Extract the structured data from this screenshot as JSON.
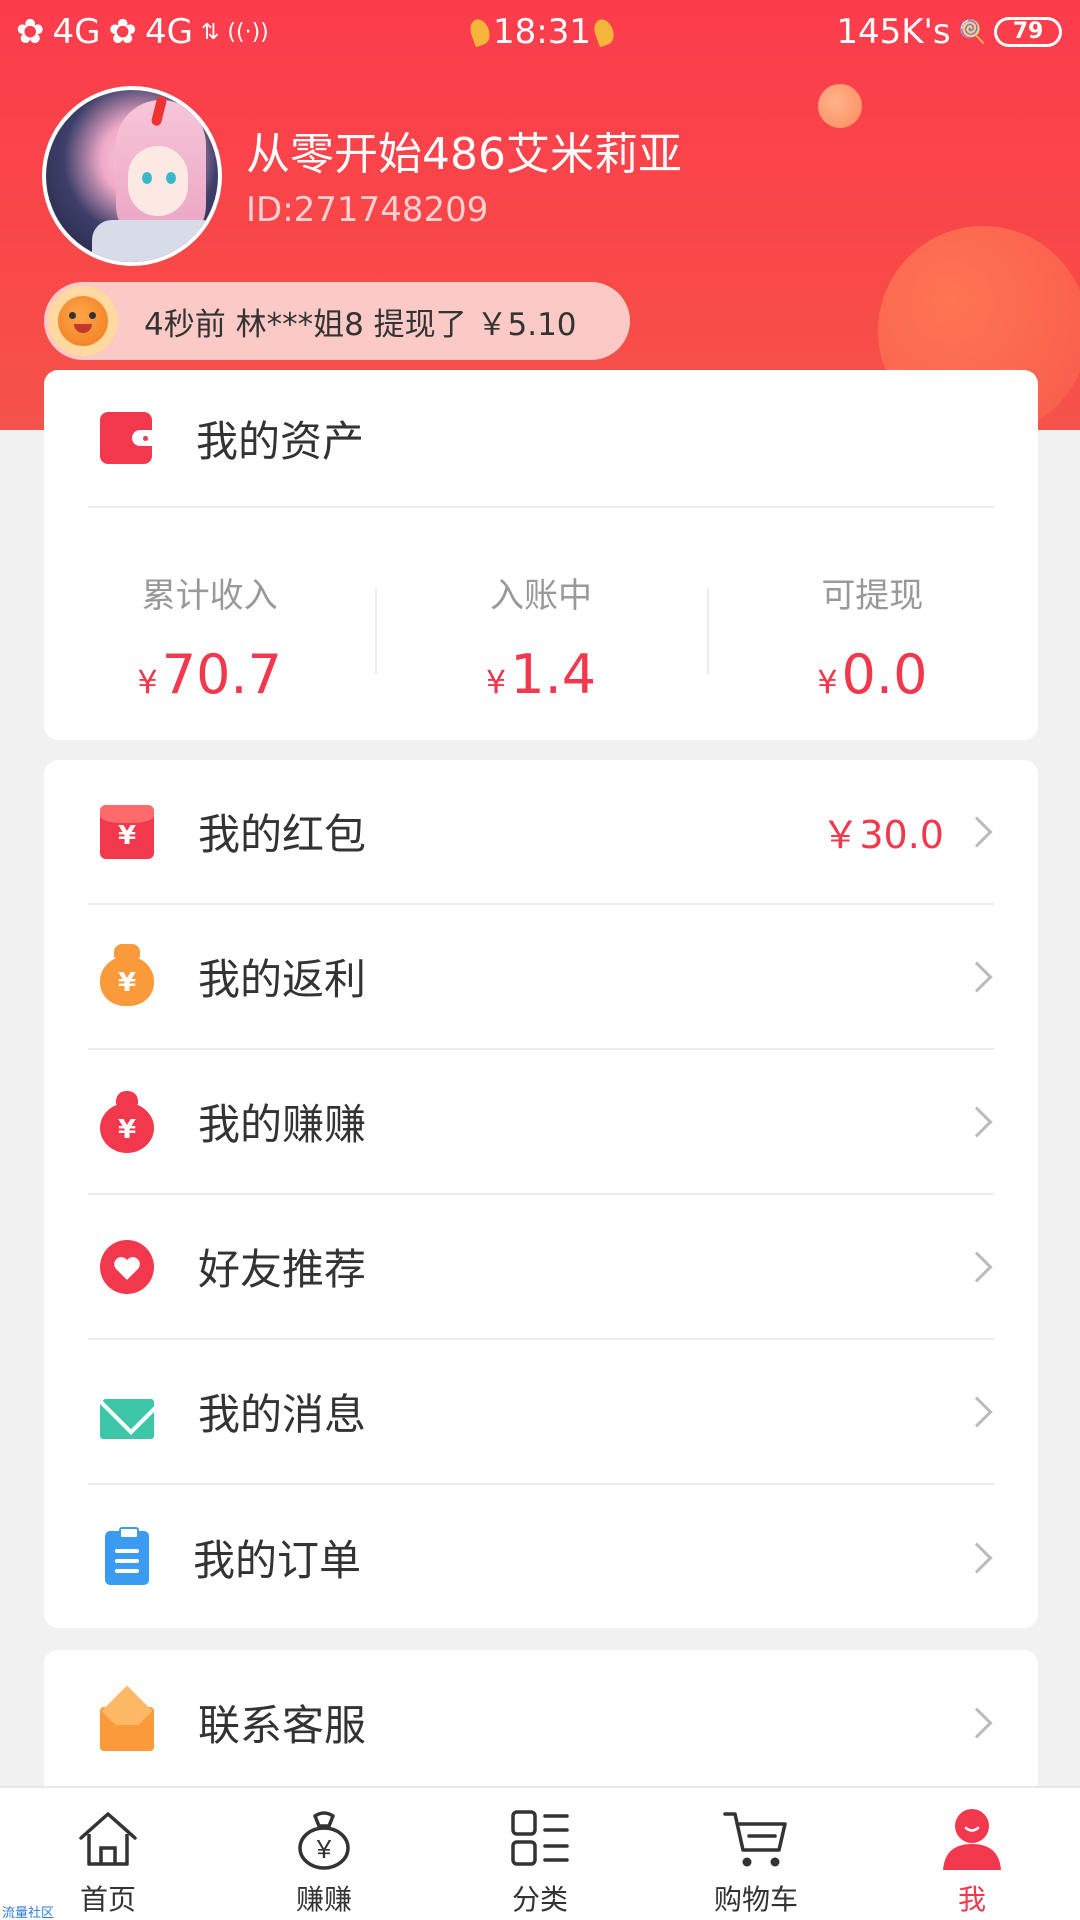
{
  "status_bar": {
    "carrier_1": "4G",
    "carrier_2": "4G",
    "time": "18:31",
    "speed": "145K's",
    "battery": "79"
  },
  "profile": {
    "username": "从零开始486艾米莉亚",
    "user_id": "ID:271748209"
  },
  "ticker": {
    "text": "4秒前 林***姐8 提现了 ￥5.10"
  },
  "assets": {
    "title": "我的资产",
    "columns": [
      {
        "label": "累计收入",
        "currency": "¥",
        "value": "70.7"
      },
      {
        "label": "入账中",
        "currency": "¥",
        "value": "1.4"
      },
      {
        "label": "可提现",
        "currency": "¥",
        "value": "0.0"
      }
    ]
  },
  "menu": {
    "items": [
      {
        "label": "我的红包",
        "extra": "￥30.0",
        "icon": "red-packet-icon"
      },
      {
        "label": "我的返利",
        "extra": "",
        "icon": "money-bag-icon"
      },
      {
        "label": "我的赚赚",
        "extra": "",
        "icon": "money-pouch-icon"
      },
      {
        "label": "好友推荐",
        "extra": "",
        "icon": "heart-icon"
      },
      {
        "label": "我的消息",
        "extra": "",
        "icon": "mail-icon"
      },
      {
        "label": "我的订单",
        "extra": "",
        "icon": "clipboard-icon"
      }
    ]
  },
  "service": {
    "label": "联系客服",
    "icon": "envelope-open-icon"
  },
  "tabbar": {
    "items": [
      {
        "label": "首页",
        "icon": "home-icon"
      },
      {
        "label": "赚赚",
        "icon": "money-bag-icon"
      },
      {
        "label": "分类",
        "icon": "category-icon"
      },
      {
        "label": "购物车",
        "icon": "cart-icon"
      },
      {
        "label": "我",
        "icon": "user-icon"
      }
    ],
    "active_index": 4
  },
  "watermark": "流量社区",
  "colors": {
    "accent": "#f2384c",
    "header": "#fc3c4c"
  }
}
